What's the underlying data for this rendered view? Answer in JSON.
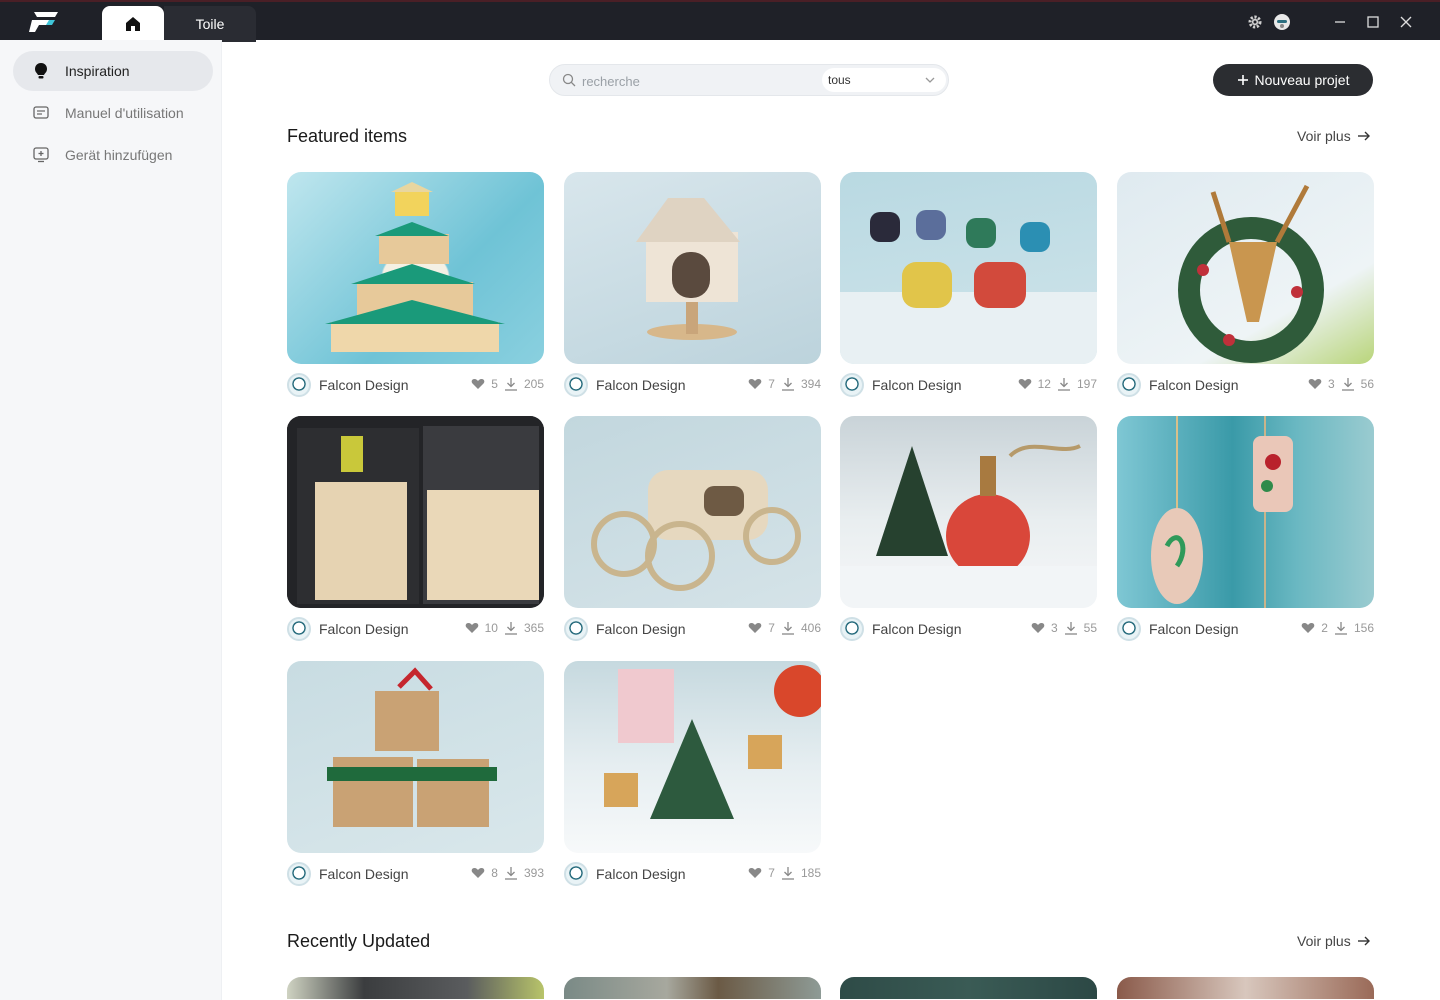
{
  "titlebar": {
    "tab_doc_label": "Toile"
  },
  "sidebar": {
    "items": [
      {
        "label": "Inspiration"
      },
      {
        "label": "Manuel d'utilisation"
      },
      {
        "label": "Gerät hinzufügen"
      }
    ]
  },
  "search": {
    "placeholder": "recherche",
    "filter_value": "tous"
  },
  "new_project_label": "Nouveau projet",
  "sections": {
    "featured": {
      "title": "Featured items",
      "more": "Voir plus"
    },
    "recent": {
      "title": "Recently Updated",
      "more": "Voir plus"
    }
  },
  "cards": [
    {
      "author": "Falcon Design",
      "likes": "5",
      "downloads": "205"
    },
    {
      "author": "Falcon Design",
      "likes": "7",
      "downloads": "394"
    },
    {
      "author": "Falcon Design",
      "likes": "12",
      "downloads": "197"
    },
    {
      "author": "Falcon Design",
      "likes": "3",
      "downloads": "56"
    },
    {
      "author": "Falcon Design",
      "likes": "10",
      "downloads": "365"
    },
    {
      "author": "Falcon Design",
      "likes": "7",
      "downloads": "406"
    },
    {
      "author": "Falcon Design",
      "likes": "3",
      "downloads": "55"
    },
    {
      "author": "Falcon Design",
      "likes": "2",
      "downloads": "156"
    },
    {
      "author": "Falcon Design",
      "likes": "8",
      "downloads": "393"
    },
    {
      "author": "Falcon Design",
      "likes": "7",
      "downloads": "185"
    }
  ],
  "colors": {
    "titlebar_bg": "#1f2128",
    "accent_dark": "#2b2d31",
    "sidebar_bg": "#f6f7f9"
  }
}
